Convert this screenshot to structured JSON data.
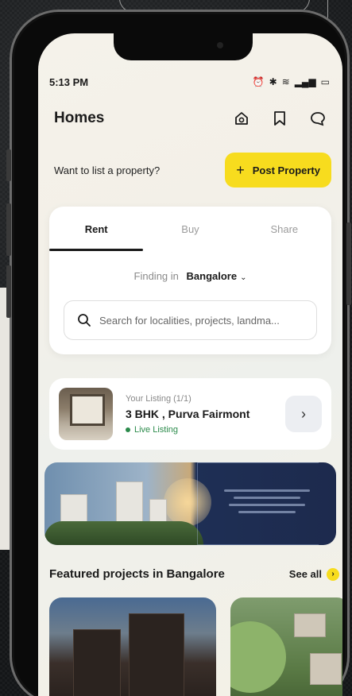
{
  "status_bar": {
    "time": "5:13 PM"
  },
  "header": {
    "title": "Homes"
  },
  "list_prompt": {
    "question": "Want to list a property?",
    "button_label": "Post Property",
    "button_plus": "+"
  },
  "search": {
    "tabs": [
      "Rent",
      "Buy",
      "Share"
    ],
    "active_tab": "Rent",
    "finding_label": "Finding in",
    "city": "Bangalore",
    "placeholder": "Search for localities, projects, landma..."
  },
  "your_listing": {
    "label": "Your Listing (1/1)",
    "name": "3 BHK , Purva Fairmont",
    "status": "Live Listing"
  },
  "featured": {
    "title": "Featured projects in Bangalore",
    "see_all": "See all"
  },
  "colors": {
    "accent": "#f7dc1e",
    "live": "#2a8a4a",
    "text": "#1a1a1a"
  }
}
